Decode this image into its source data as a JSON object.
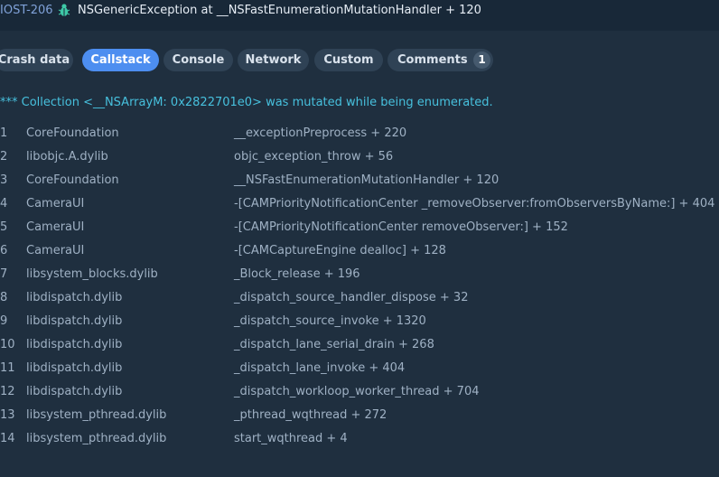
{
  "header": {
    "issue_id": "IOST-206",
    "title": "NSGenericException at __NSFastEnumerationMutationHandler + 120"
  },
  "tabs": [
    {
      "label": "Crash data"
    },
    {
      "label": "Callstack"
    },
    {
      "label": "Console"
    },
    {
      "label": "Network"
    },
    {
      "label": "Custom"
    },
    {
      "label": "Comments",
      "count": "1"
    }
  ],
  "callstack": {
    "message": "*** Collection <__NSArrayM: 0x2822701e0> was mutated while being enumerated.",
    "frames": [
      {
        "num": "1",
        "lib": "CoreFoundation",
        "symbol": "__exceptionPreprocess + 220"
      },
      {
        "num": "2",
        "lib": "libobjc.A.dylib",
        "symbol": "objc_exception_throw + 56"
      },
      {
        "num": "3",
        "lib": "CoreFoundation",
        "symbol": "__NSFastEnumerationMutationHandler + 120"
      },
      {
        "num": "4",
        "lib": "CameraUI",
        "symbol": "-[CAMPriorityNotificationCenter _removeObserver:fromObserversByName:] + 404"
      },
      {
        "num": "5",
        "lib": "CameraUI",
        "symbol": "-[CAMPriorityNotificationCenter removeObserver:] + 152"
      },
      {
        "num": "6",
        "lib": "CameraUI",
        "symbol": "-[CAMCaptureEngine dealloc] + 128"
      },
      {
        "num": "7",
        "lib": "libsystem_blocks.dylib",
        "symbol": "_Block_release + 196"
      },
      {
        "num": "8",
        "lib": "libdispatch.dylib",
        "symbol": "_dispatch_source_handler_dispose + 32"
      },
      {
        "num": "9",
        "lib": "libdispatch.dylib",
        "symbol": "_dispatch_source_invoke + 1320"
      },
      {
        "num": "10",
        "lib": "libdispatch.dylib",
        "symbol": "_dispatch_lane_serial_drain + 268"
      },
      {
        "num": "11",
        "lib": "libdispatch.dylib",
        "symbol": "_dispatch_lane_invoke + 404"
      },
      {
        "num": "12",
        "lib": "libdispatch.dylib",
        "symbol": "_dispatch_workloop_worker_thread + 704"
      },
      {
        "num": "13",
        "lib": "libsystem_pthread.dylib",
        "symbol": "_pthread_wqthread + 272"
      },
      {
        "num": "14",
        "lib": "libsystem_pthread.dylib",
        "symbol": "start_wqthread + 4"
      }
    ]
  },
  "colors": {
    "background": "#1f2f3f",
    "active_tab": "#4d8ef0",
    "message": "#47c0dd",
    "bug_icon": "#3ec9a7"
  },
  "icons": {
    "issue_type": "bug-icon"
  }
}
